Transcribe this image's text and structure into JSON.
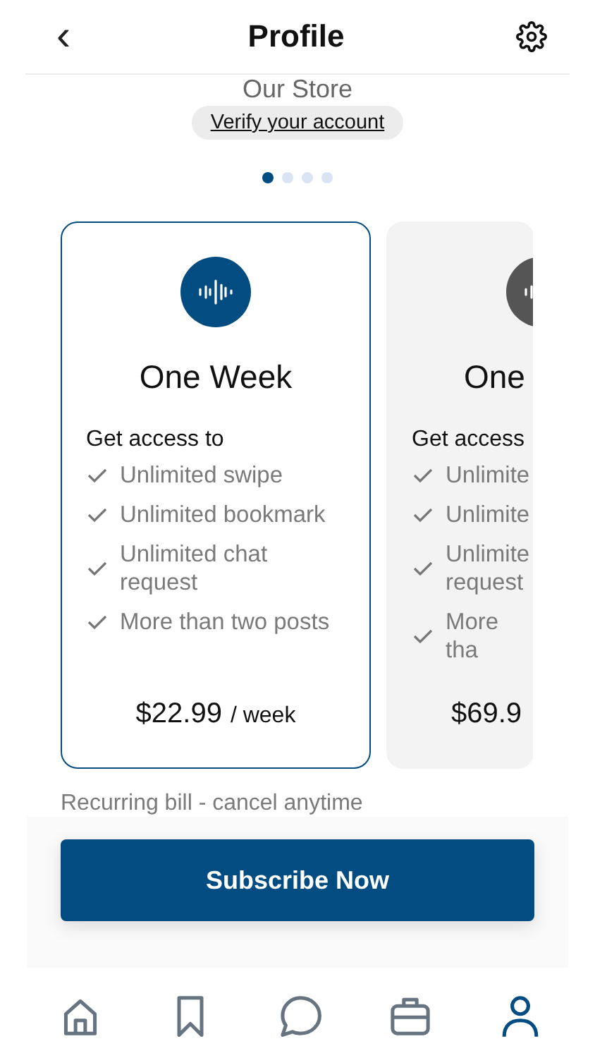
{
  "header": {
    "back": "‹",
    "title": "Profile"
  },
  "store_title": "Our Store",
  "verify_link": "Verify your account",
  "dots": [
    {
      "selected": true
    },
    {
      "selected": false
    },
    {
      "selected": false
    },
    {
      "selected": false
    }
  ],
  "plans": [
    {
      "selected": true,
      "title": "One Week",
      "intro": "Get access to",
      "features": [
        "Unlimited swipe",
        "Unlimited bookmark",
        "Unlimited chat request",
        "More than two posts"
      ],
      "price": "$22.99",
      "period": "/ week"
    },
    {
      "selected": false,
      "title": "One",
      "intro": "Get access",
      "features": [
        "Unlimite",
        "Unlimite",
        "Unlimite request",
        "More tha"
      ],
      "price": "$69.9"
    }
  ],
  "note": "Recurring bill - cancel anytime",
  "subscribe_button": "Subscribe Now",
  "nav": [
    {
      "kind": "home",
      "selected": false
    },
    {
      "kind": "bookmark",
      "selected": false
    },
    {
      "kind": "chat",
      "selected": false
    },
    {
      "kind": "briefcase",
      "selected": false
    },
    {
      "kind": "profile",
      "selected": true
    }
  ]
}
